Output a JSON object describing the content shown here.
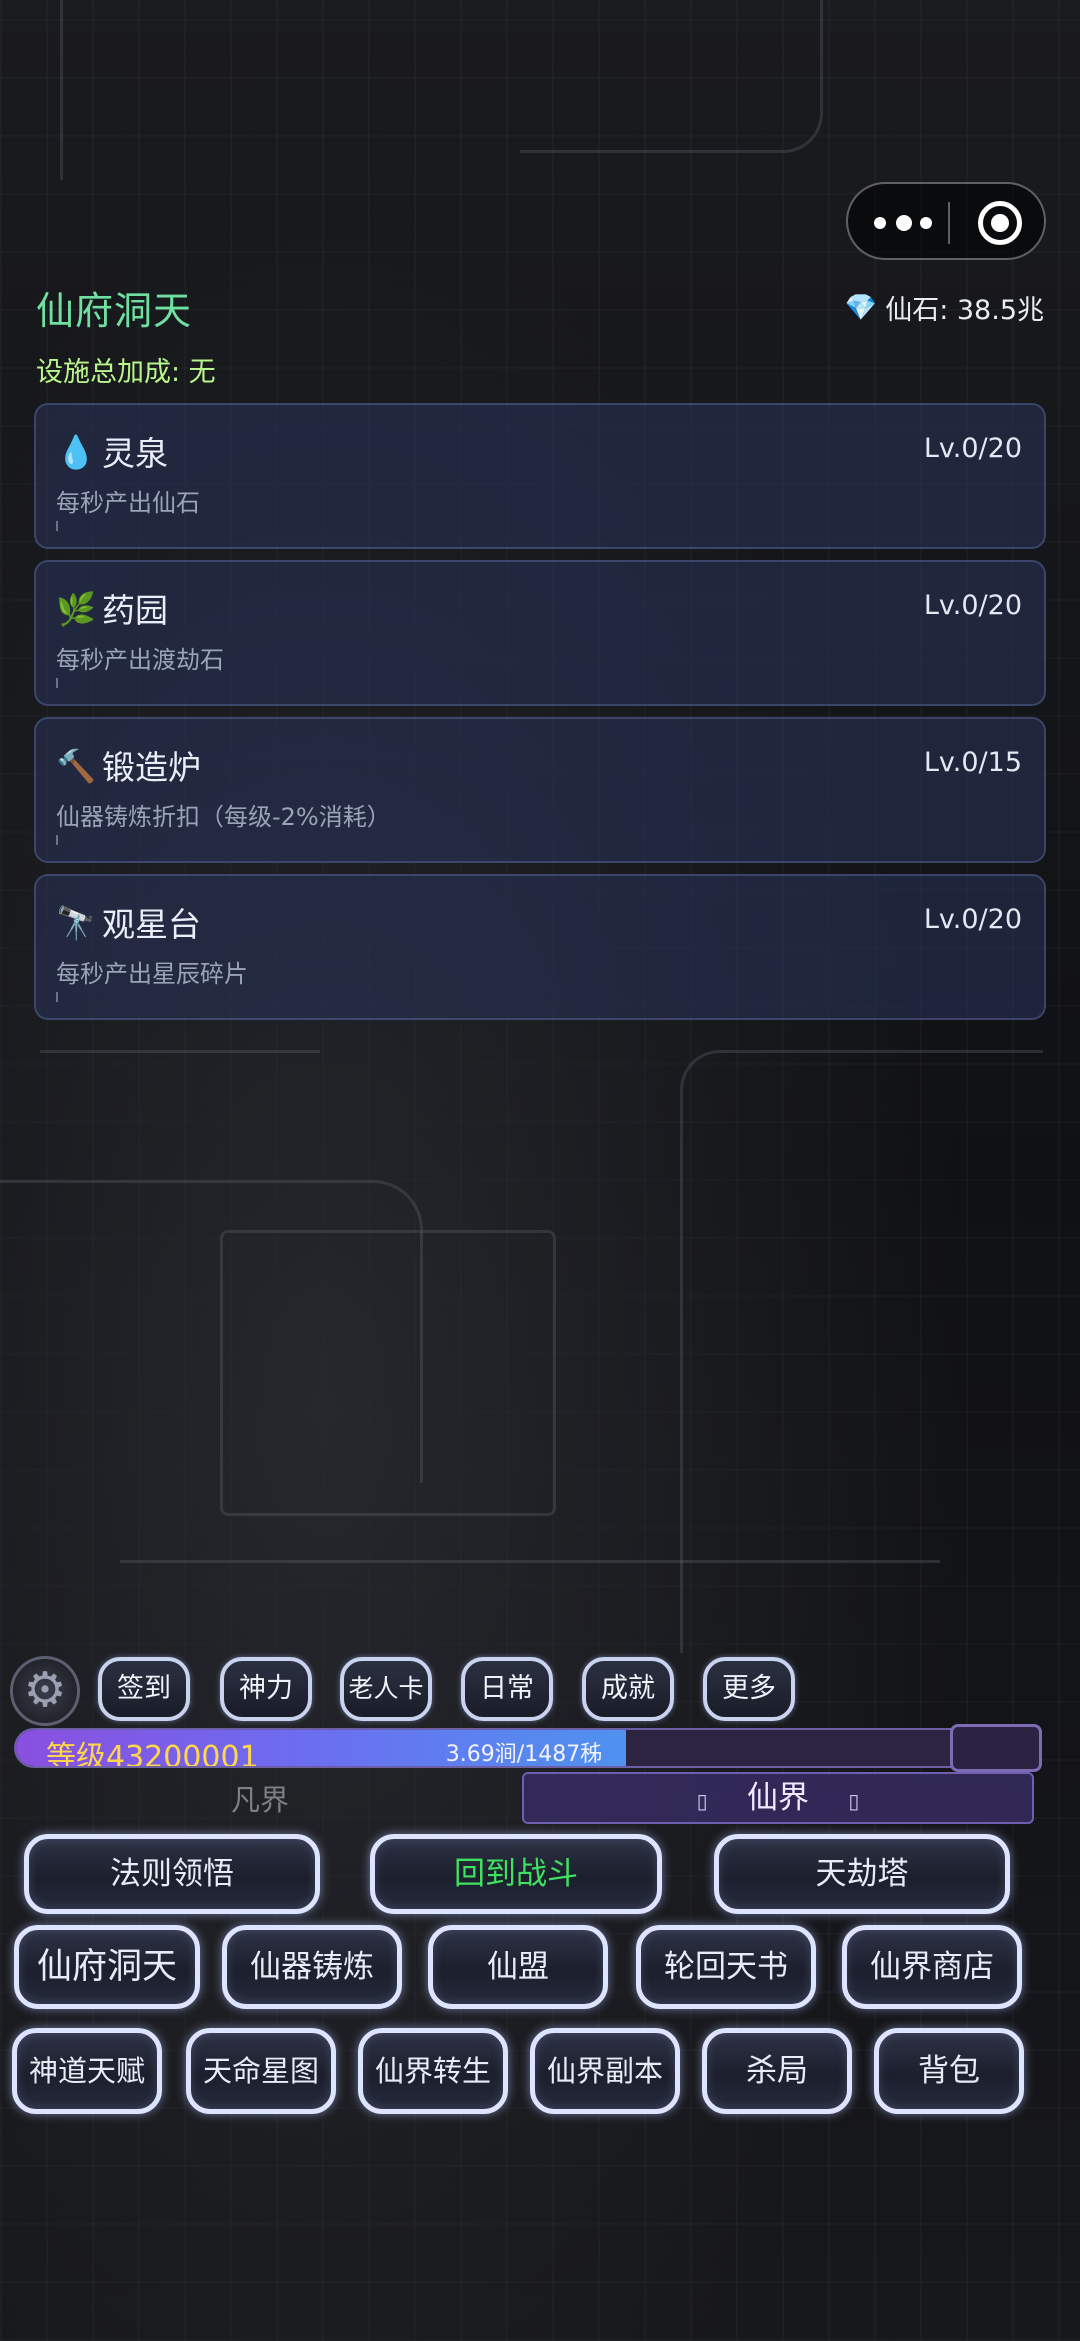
{
  "header": {
    "title": "仙府洞天",
    "currency_label": "仙石: 38.5兆",
    "currency_icon": "diamond-icon",
    "bonus_text": "设施总加成: 无"
  },
  "facilities": [
    {
      "icon": "💧",
      "icon_name": "water-drop-icon",
      "name": "灵泉",
      "level": "Lv.0/20",
      "desc": "每秒产出仙石"
    },
    {
      "icon": "🌿",
      "icon_name": "herb-icon",
      "name": "药园",
      "level": "Lv.0/20",
      "desc": "每秒产出渡劫石"
    },
    {
      "icon": "🔨",
      "icon_name": "hammer-icon",
      "name": "锻造炉",
      "level": "Lv.0/15",
      "desc": "仙器铸炼折扣（每级-2%消耗）"
    },
    {
      "icon": "🔭",
      "icon_name": "telescope-icon",
      "name": "观星台",
      "level": "Lv.0/20",
      "desc": "每秒产出星辰碎片"
    }
  ],
  "quick_menu": [
    "签到",
    "神力",
    "老人卡",
    "日常",
    "成就",
    "更多"
  ],
  "status": {
    "level_label": "等级43200001",
    "exp_label": "3.69涧/1487秭",
    "exp_progress": 0.6
  },
  "realm_tabs": {
    "mortal": "凡界",
    "immortal": "仙界",
    "immortal_side_glyph": "▯"
  },
  "nav_row1": [
    "法则领悟",
    "回到战斗",
    "天劫塔"
  ],
  "nav_row2": [
    "仙府洞天",
    "仙器铸炼",
    "仙盟",
    "轮回天书",
    "仙界商店"
  ],
  "nav_row3": [
    "神道天赋",
    "天命星图",
    "仙界转生",
    "仙界副本",
    "杀局",
    "背包"
  ],
  "colors": {
    "title": "#6fe0a1",
    "bonus": "#b9f58c",
    "level_text": "#ffd64a",
    "battle_button": "#40e060"
  }
}
